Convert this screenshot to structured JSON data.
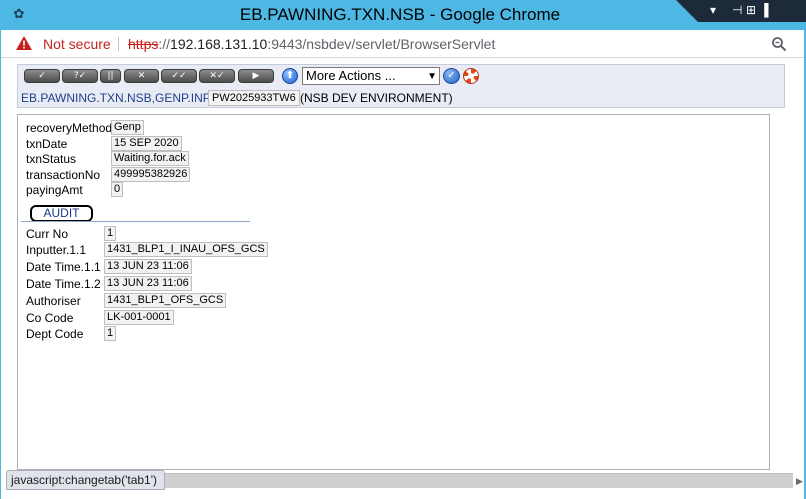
{
  "window": {
    "title": "EB.PAWNING.TXN.NSB - Google Chrome"
  },
  "address_bar": {
    "security_label": "Not secure",
    "url_scheme": "https",
    "url_host": "192.168.131.10",
    "url_rest": ":9443/nsbdev/servlet/BrowserServlet"
  },
  "toolbar": {
    "buttons": [
      {
        "label": "✓",
        "name": "commit-button"
      },
      {
        "label": "?✓",
        "name": "validate-button"
      },
      {
        "label": "||",
        "name": "hold-button"
      },
      {
        "label": "✕",
        "name": "delete-button"
      },
      {
        "label": "✓✓",
        "name": "authorise-button"
      },
      {
        "label": "✕✓",
        "name": "reverse-button"
      },
      {
        "label": "▶",
        "name": "next-button"
      }
    ],
    "actions_select": "More Actions ...",
    "app_name": "EB.PAWNING.TXN.NSB,GENP.INPUT",
    "transaction_id": "PW2025933TW6",
    "environment": "(NSB DEV ENVIRONMENT)"
  },
  "fields": [
    {
      "label": "recoveryMethod",
      "value": "Genp"
    },
    {
      "label": "txnDate",
      "value": "15 SEP 2020"
    },
    {
      "label": "txnStatus",
      "value": "Waiting.for.ack"
    },
    {
      "label": "transactionNo",
      "value": "499995382926"
    },
    {
      "label": "payingAmt",
      "value": "0"
    }
  ],
  "audit": {
    "tab_label": "AUDIT",
    "fields": [
      {
        "label": "Curr No",
        "value": "1"
      },
      {
        "label": "Inputter.1.1",
        "value": "1431_BLP1_I_INAU_OFS_GCS"
      },
      {
        "label": "Date Time.1.1",
        "value": "13 JUN 23 11:06"
      },
      {
        "label": "Date Time.1.2",
        "value": "13 JUN 23 11:06"
      },
      {
        "label": "Authoriser",
        "value": "1431_BLP1_OFS_GCS"
      },
      {
        "label": "Co Code",
        "value": "LK-001-0001"
      },
      {
        "label": "Dept Code",
        "value": "1"
      }
    ]
  },
  "status_bar": {
    "text": "javascript:changetab('tab1')"
  },
  "colors": {
    "window_frame": "#4cb8e3",
    "insecure_red": "#c5221f",
    "app_title_blue": "#1f3f8a"
  }
}
